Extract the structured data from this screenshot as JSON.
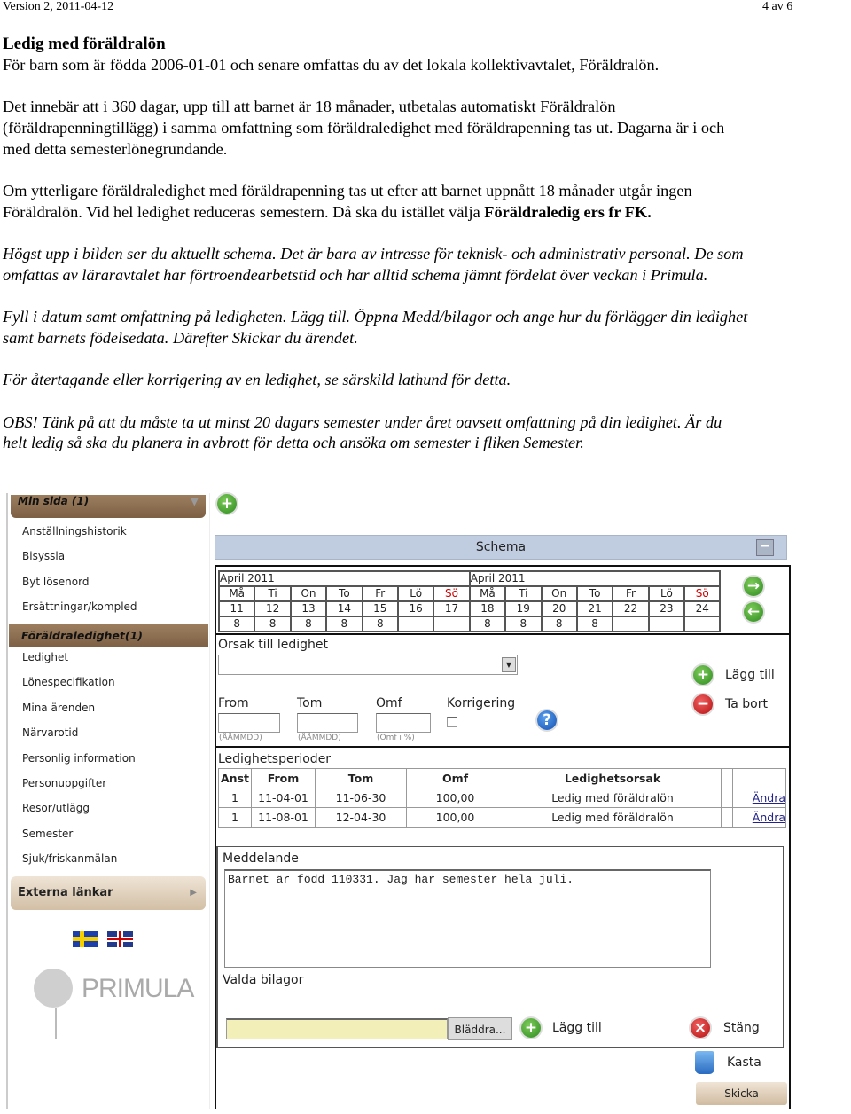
{
  "header": {
    "version": "Version 2, 2011-04-12",
    "page": "4 av 6"
  },
  "doc": {
    "title": "Ledig med föräldralön",
    "p1": [
      "För barn som är födda 2006-01-01 och senare omfattas du av det lokala kollektivavtalet, Föräldralön."
    ],
    "p2": [
      "Det innebär att i 360 dagar, upp till att barnet är 18 månader, utbetalas automatiskt Föräldralön",
      "(föräldrapenningtillägg) i samma omfattning som föräldraledighet med föräldrapenning tas ut. Dagarna är i och",
      "med detta semesterlönegrundande."
    ],
    "p3": [
      "Om ytterligare föräldraledighet med föräldrapenning tas ut efter att barnet uppnått 18 månader utgår ingen",
      "Föräldralön. Vid hel ledighet reduceras semestern. Då ska du istället välja "
    ],
    "p3_bold": "Föräldraledig ers fr FK.",
    "p4": [
      "Högst upp i bilden ser du aktuellt schema. Det är bara av intresse för teknisk- och administrativ personal. De som",
      "omfattas av läraravtalet har förtroendearbetstid och har alltid schema jämnt fördelat över veckan i Primula."
    ],
    "p5": [
      "Fyll i datum samt omfattning på ledigheten. Lägg till. Öppna Medd/bilagor och ange hur du förlägger din ledighet",
      "samt barnets födelsedata. Därefter Skickar du ärendet."
    ],
    "p6": [
      "För återtagande eller korrigering av en ledighet, se särskild lathund för detta."
    ],
    "p7": [
      "OBS! Tänk på att du måste ta ut minst 20 dagars semester under året oavsett omfattning på din ledighet. Är du",
      "helt ledig så ska du planera in avbrott för detta och ansöka om semester i fliken Semester."
    ]
  },
  "sidebar": {
    "header": "Min sida (1)",
    "items": [
      "Anställningshistorik",
      "Bisyssla",
      "Byt lösenord",
      "Ersättningar/kompled",
      "Föräldraledighet(1)",
      "Ledighet",
      "Lönespecifikation",
      "Mina ärenden",
      "Närvarotid",
      "Personlig information",
      "Personuppgifter",
      "Resor/utlägg",
      "Semester",
      "Sjuk/friskanmälan"
    ],
    "selected_index": 4,
    "external": "Externa länkar",
    "logo": "PRIMULA"
  },
  "schema": {
    "title": "Schema",
    "weeks": [
      {
        "month": "April 2011",
        "days": [
          "Må",
          "Ti",
          "On",
          "To",
          "Fr",
          "Lö",
          "Sö"
        ],
        "dates": [
          "11",
          "12",
          "13",
          "14",
          "15",
          "16",
          "17"
        ],
        "hours": [
          "8",
          "8",
          "8",
          "8",
          "8",
          "",
          ""
        ]
      },
      {
        "month": "April 2011",
        "days": [
          "Må",
          "Ti",
          "On",
          "To",
          "Fr",
          "Lö",
          "Sö"
        ],
        "dates": [
          "18",
          "19",
          "20",
          "21",
          "22",
          "23",
          "24"
        ],
        "hours": [
          "8",
          "8",
          "8",
          "8",
          "",
          "",
          ""
        ]
      }
    ],
    "sunday_color": "#cc0000"
  },
  "form": {
    "reason_label": "Orsak till ledighet",
    "reason_value": "",
    "from_label": "From",
    "tom_label": "Tom",
    "omf_label": "Omf",
    "korr_label": "Korrigering",
    "from_hint": "(ÅÅMMDD)",
    "tom_hint": "(ÅÅMMDD)",
    "omf_hint": "(Omf i %)",
    "add": "Lägg till",
    "remove": "Ta bort"
  },
  "periods": {
    "title": "Ledighetsperioder",
    "headers": [
      "Anst",
      "From",
      "Tom",
      "Omf",
      "Ledighetsorsak",
      "",
      ""
    ],
    "rows": [
      [
        "1",
        "11-04-01",
        "11-06-30",
        "100,00",
        "Ledig med föräldralön",
        "",
        "Ändra"
      ],
      [
        "1",
        "11-08-01",
        "12-04-30",
        "100,00",
        "Ledig med föräldralön",
        "",
        "Ändra"
      ]
    ]
  },
  "message": {
    "label": "Meddelande",
    "text": "Barnet är född 110331. Jag har semester hela juli.",
    "attach_label": "Valda bilagor",
    "browse": "Bläddra...",
    "add": "Lägg till",
    "close": "Stäng",
    "discard": "Kasta",
    "send": "Skicka"
  }
}
